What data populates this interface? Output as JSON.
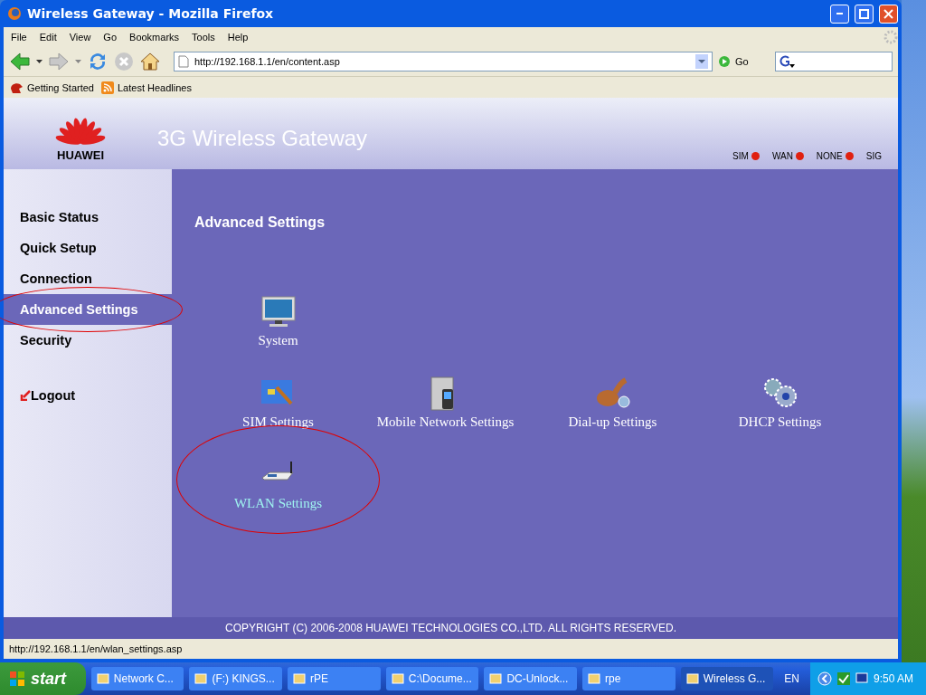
{
  "window": {
    "title": "Wireless Gateway - Mozilla Firefox"
  },
  "menu": [
    "File",
    "Edit",
    "View",
    "Go",
    "Bookmarks",
    "Tools",
    "Help"
  ],
  "address": {
    "value": "http://192.168.1.1/en/content.asp",
    "go": "Go"
  },
  "bookmarks": [
    {
      "kind": "page",
      "label": "Getting Started"
    },
    {
      "kind": "feed",
      "label": "Latest Headlines"
    }
  ],
  "header": {
    "logo": "HUAWEI",
    "title": "3G Wireless Gateway",
    "indicators": [
      {
        "label": "SIM",
        "lit": true
      },
      {
        "label": "WAN",
        "lit": true
      },
      {
        "label": "NONE",
        "lit": true
      },
      {
        "label": "SIG",
        "lit": false
      }
    ]
  },
  "sidebar": {
    "items": [
      {
        "label": "Basic Status",
        "selected": false,
        "circled": false
      },
      {
        "label": "Quick Setup",
        "selected": false,
        "circled": false
      },
      {
        "label": "Connection",
        "selected": false,
        "circled": false
      },
      {
        "label": "Advanced Settings",
        "selected": true,
        "circled": true
      },
      {
        "label": "Security",
        "selected": false,
        "circled": false
      }
    ],
    "logout": "Logout"
  },
  "main": {
    "heading": "Advanced Settings",
    "rows": [
      [
        {
          "kind": "monitor",
          "label": "System",
          "hovered": false,
          "circled": false
        }
      ],
      [
        {
          "kind": "sim",
          "label": "SIM Settings",
          "hovered": false,
          "circled": false
        },
        {
          "kind": "phone",
          "label": "Mobile Network Settings",
          "hovered": false,
          "circled": false
        },
        {
          "kind": "dialup",
          "label": "Dial-up Settings",
          "hovered": false,
          "circled": false
        },
        {
          "kind": "gears",
          "label": "DHCP Settings",
          "hovered": false,
          "circled": false
        }
      ],
      [
        {
          "kind": "router",
          "label": "WLAN Settings",
          "hovered": true,
          "circled": true
        }
      ]
    ]
  },
  "footer": "COPYRIGHT (C) 2006-2008 HUAWEI TECHNOLOGIES CO.,LTD. ALL RIGHTS RESERVED.",
  "status_bar": "http://192.168.1.1/en/wlan_settings.asp",
  "taskbar": {
    "start": "start",
    "tasks": [
      {
        "label": "Network C...",
        "selected": false
      },
      {
        "label": "(F:) KINGS...",
        "selected": false
      },
      {
        "label": "rPE",
        "selected": false
      },
      {
        "label": "C:\\Docume...",
        "selected": false
      },
      {
        "label": "DC-Unlock...",
        "selected": false
      },
      {
        "label": "rpe",
        "selected": false
      },
      {
        "label": "Wireless G...",
        "selected": true
      }
    ],
    "language": "EN",
    "clock": "9:50 AM"
  }
}
